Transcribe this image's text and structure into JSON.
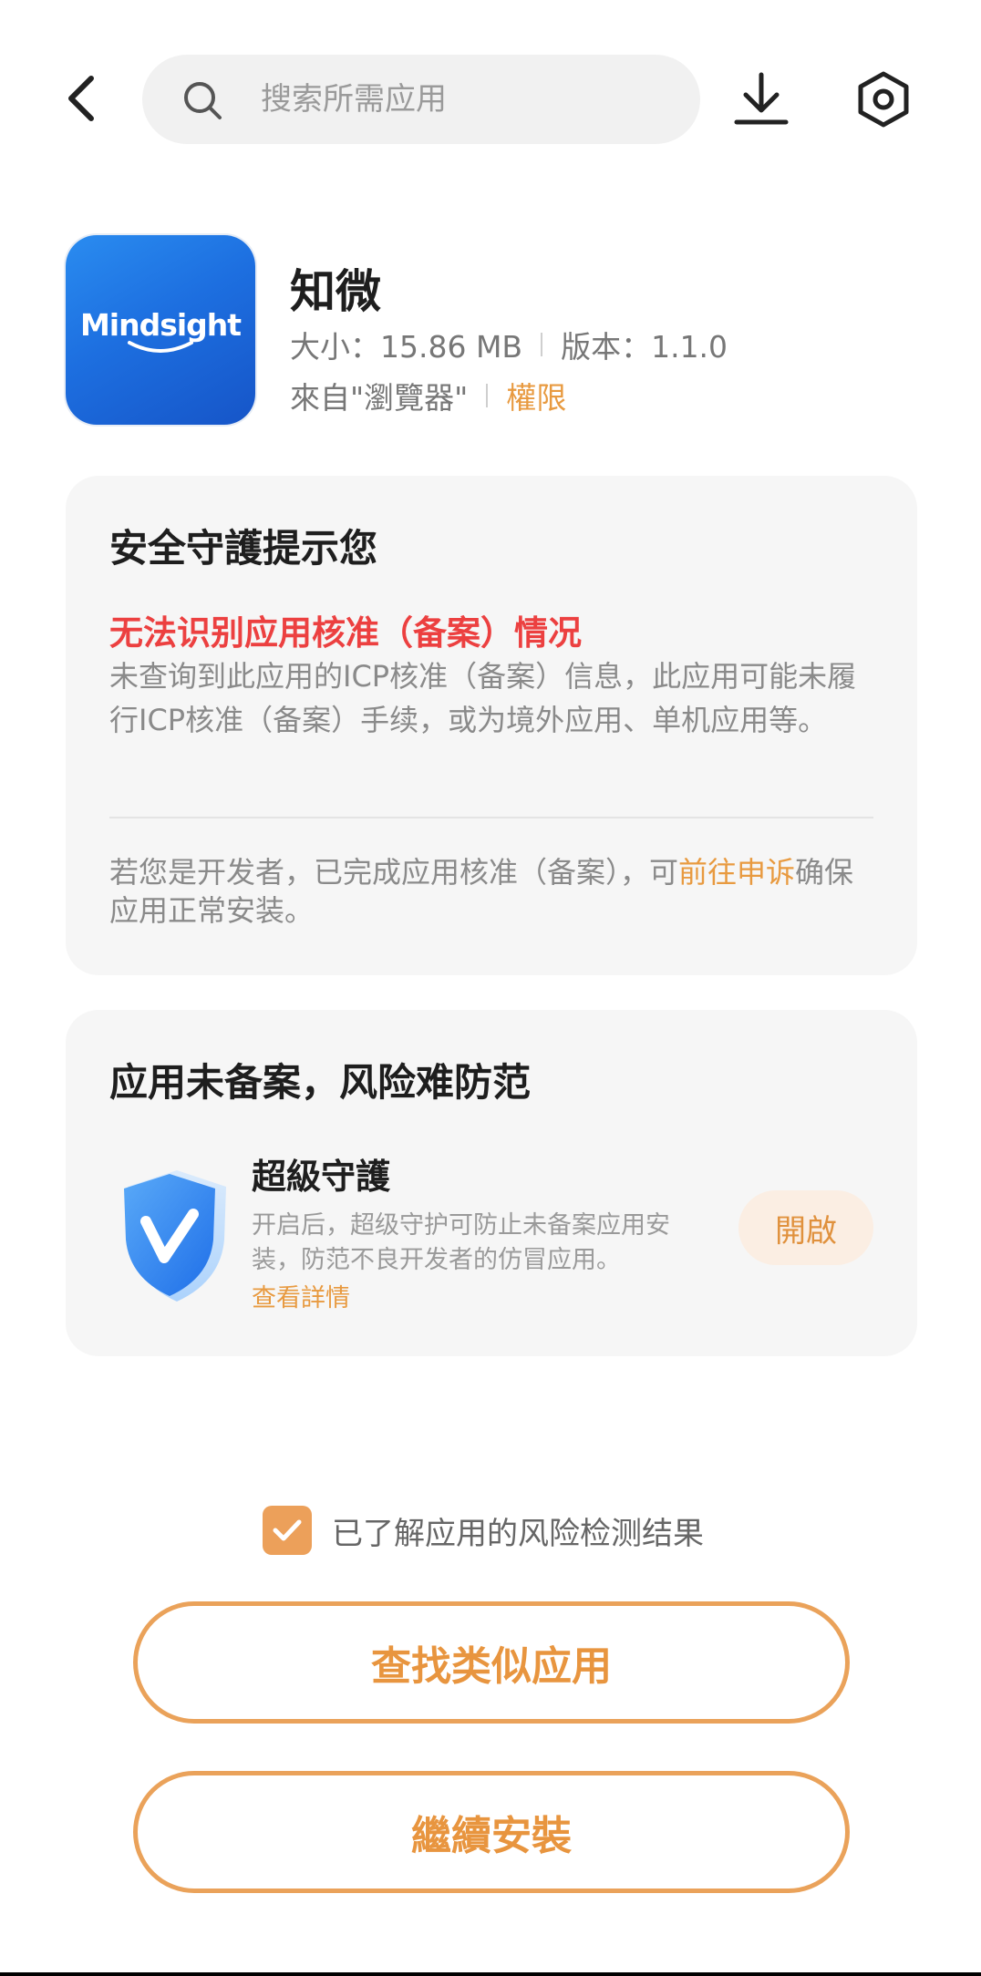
{
  "header": {
    "search_placeholder": "搜索所需应用"
  },
  "app": {
    "logo_text": "Mindsight",
    "name": "知微",
    "size": "大小：15.86 MB",
    "version": "版本：1.1.0",
    "source": "來自\"瀏覽器\"",
    "permissions_link": "權限"
  },
  "security_card": {
    "title": "安全守護提示您",
    "warning_title": "无法识别应用核准（备案）情况",
    "warning_desc": "未查询到此应用的ICP核准（备案）信息，此应用可能未履行ICP核准（备案）手续，或为境外应用、单机应用等。",
    "appeal_prefix": "若您是开发者，已完成应用核准（备案），可",
    "appeal_link": "前往申诉",
    "appeal_suffix": "确保应用正常安装。"
  },
  "risk_card": {
    "title": "应用未备案，风险难防范",
    "guard_title": "超級守護",
    "guard_desc": "开启后，超级守护可防止未备案应用安装，防范不良开发者的仿冒应用。",
    "details_link": "查看詳情",
    "enable_label": "開啟"
  },
  "consent": {
    "checked": true,
    "label": "已了解应用的风险检测结果"
  },
  "actions": {
    "find_similar": "查找类似应用",
    "continue_install": "繼續安裝"
  },
  "colors": {
    "accent": "#E8953F",
    "warning": "#EC4040",
    "card_bg": "#F6F6F6"
  }
}
